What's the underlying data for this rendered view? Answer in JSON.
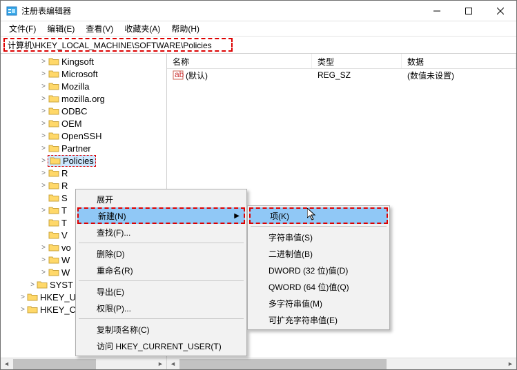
{
  "window": {
    "title": "注册表编辑器"
  },
  "menubar": [
    "文件(F)",
    "编辑(E)",
    "查看(V)",
    "收藏夹(A)",
    "帮助(H)"
  ],
  "address": "计算机\\HKEY_LOCAL_MACHINE\\SOFTWARE\\Policies",
  "tree": {
    "indent_base": 56,
    "items": [
      {
        "label": "Kingsoft",
        "twisty": ">"
      },
      {
        "label": "Microsoft",
        "twisty": ">"
      },
      {
        "label": "Mozilla",
        "twisty": ">"
      },
      {
        "label": "mozilla.org",
        "twisty": ">"
      },
      {
        "label": "ODBC",
        "twisty": ">"
      },
      {
        "label": "OEM",
        "twisty": ">"
      },
      {
        "label": "OpenSSH",
        "twisty": ">"
      },
      {
        "label": "Partner",
        "twisty": ">"
      },
      {
        "label": "Policies",
        "twisty": ">",
        "selected": true
      },
      {
        "label": "R",
        "twisty": ">"
      },
      {
        "label": "R",
        "twisty": ">"
      },
      {
        "label": "S",
        "twisty": ""
      },
      {
        "label": "T",
        "twisty": ">"
      },
      {
        "label": "T",
        "twisty": ""
      },
      {
        "label": "V",
        "twisty": ""
      },
      {
        "label": "vo",
        "twisty": ">"
      },
      {
        "label": "W",
        "twisty": ">"
      },
      {
        "label": "W",
        "twisty": ">"
      }
    ],
    "tail": [
      {
        "label": "SYST",
        "indent": 40,
        "twisty": ">"
      },
      {
        "label": "HKEY_USERS",
        "indent": 26,
        "twisty": ">"
      },
      {
        "label": "HKEY_CURRENT_CONFIG",
        "indent": 26,
        "twisty": ">"
      }
    ]
  },
  "list": {
    "headers": {
      "name": "名称",
      "type": "类型",
      "data": "数据"
    },
    "rows": [
      {
        "name": "(默认)",
        "type": "REG_SZ",
        "data": "(数值未设置)"
      }
    ]
  },
  "ctx1": {
    "items": [
      {
        "label": "展开",
        "kind": "plain"
      },
      {
        "label": "新建(N)",
        "kind": "sub",
        "hover": true,
        "red": true
      },
      {
        "label": "查找(F)...",
        "kind": "plain"
      },
      {
        "sep": true
      },
      {
        "label": "删除(D)",
        "kind": "plain"
      },
      {
        "label": "重命名(R)",
        "kind": "plain"
      },
      {
        "sep": true
      },
      {
        "label": "导出(E)",
        "kind": "plain"
      },
      {
        "label": "权限(P)...",
        "kind": "plain"
      },
      {
        "sep": true
      },
      {
        "label": "复制项名称(C)",
        "kind": "plain"
      },
      {
        "label": "访问 HKEY_CURRENT_USER(T)",
        "kind": "plain"
      }
    ]
  },
  "ctx2": {
    "items": [
      {
        "label": "项(K)",
        "hover": true,
        "red": true
      },
      {
        "sep": true
      },
      {
        "label": "字符串值(S)"
      },
      {
        "label": "二进制值(B)"
      },
      {
        "label": "DWORD (32 位)值(D)"
      },
      {
        "label": "QWORD (64 位)值(Q)"
      },
      {
        "label": "多字符串值(M)"
      },
      {
        "label": "可扩充字符串值(E)"
      }
    ]
  }
}
